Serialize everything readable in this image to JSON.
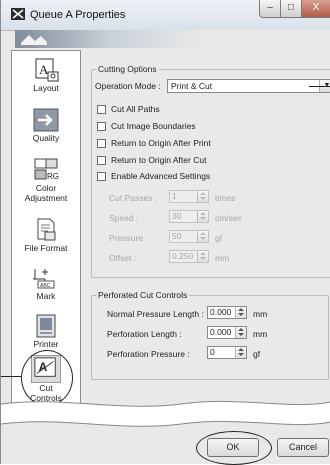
{
  "window": {
    "title": "Queue A Properties",
    "controls": {
      "minimize": "–",
      "maximize": "□",
      "close": "X"
    }
  },
  "sidebar": {
    "items": [
      {
        "label": "Layout",
        "icon": "layout-icon"
      },
      {
        "label": "Quality",
        "icon": "quality-icon"
      },
      {
        "label": "Color Adjustment",
        "icon": "color-adjustment-icon"
      },
      {
        "label": "File Format",
        "icon": "file-format-icon"
      },
      {
        "label": "Mark",
        "icon": "mark-icon"
      },
      {
        "label": "Printer",
        "icon": "printer-icon"
      },
      {
        "label": "Cut Controls",
        "icon": "cut-controls-icon",
        "selected": true
      }
    ]
  },
  "cutting_options": {
    "title": "Cutting Options",
    "operation_mode_label": "Operation Mode :",
    "operation_mode_value": "Print & Cut",
    "checkboxes": [
      {
        "label": "Cut All Paths",
        "checked": false
      },
      {
        "label": "Cut Image Boundaries",
        "checked": false
      },
      {
        "label": "Return to Origin After Print",
        "checked": false
      },
      {
        "label": "Return to Origin After Cut",
        "checked": false
      },
      {
        "label": "Enable Advanced Settings",
        "checked": false
      }
    ],
    "advanced": [
      {
        "label": "Cut Passes :",
        "value": "1",
        "unit": "times"
      },
      {
        "label": "Speed :",
        "value": "30",
        "unit": "cm/sec"
      },
      {
        "label": "Pressure :",
        "value": "50",
        "unit": "gf"
      },
      {
        "label": "Offset :",
        "value": "0.250",
        "unit": "mm"
      }
    ]
  },
  "perforated": {
    "title": "Perforated Cut Controls",
    "fields": [
      {
        "label": "Normal Pressure Length :",
        "value": "0.000",
        "unit": "mm"
      },
      {
        "label": "Perforation Length :",
        "value": "0.000",
        "unit": "mm"
      },
      {
        "label": "Perforation Pressure :",
        "value": "0",
        "unit": "gf"
      }
    ]
  },
  "footer": {
    "ok_label": "OK",
    "cancel_label": "Cancel"
  },
  "colors": {
    "dialog_bg": "#e9e9e9",
    "sidebar_bg": "#ffffff",
    "disabled_text": "#a7a7a7"
  }
}
